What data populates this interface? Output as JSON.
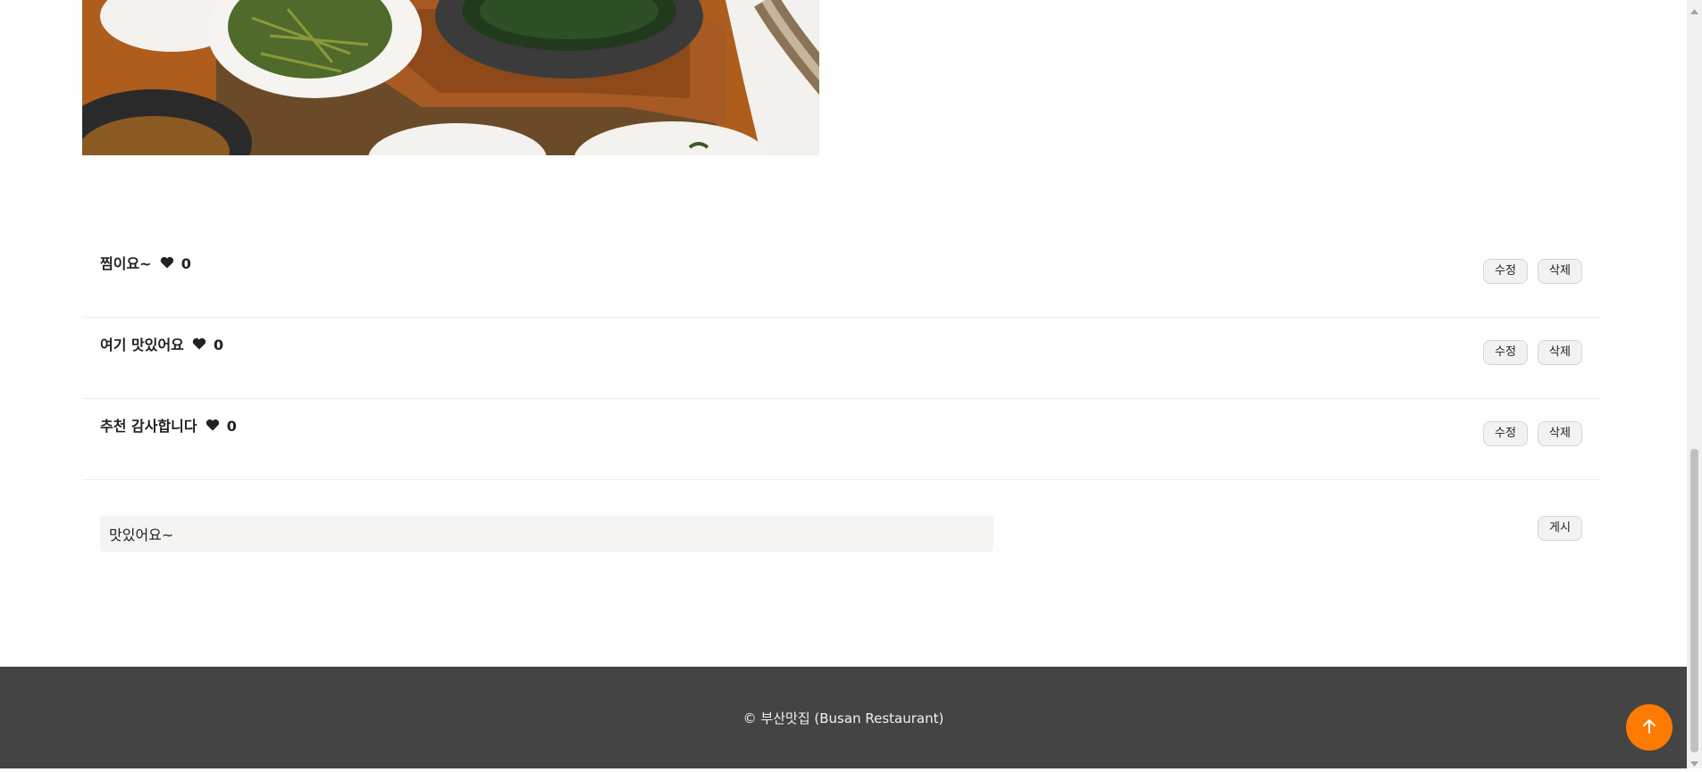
{
  "comments": [
    {
      "text": "찜이요~",
      "likes": "0",
      "edit_label": "수정",
      "delete_label": "삭제"
    },
    {
      "text": "여기 맛있어요",
      "likes": "0",
      "edit_label": "수정",
      "delete_label": "삭제"
    },
    {
      "text": "추천 감사합니다",
      "likes": "0",
      "edit_label": "수정",
      "delete_label": "삭제"
    }
  ],
  "comment_form": {
    "input_value": "맛있어요~",
    "post_label": "게시"
  },
  "footer": {
    "copyright": "© 부산맛집 (Busan Restaurant)"
  },
  "icons": {
    "like": "heart-icon",
    "scroll_top": "arrow-up-icon"
  },
  "colors": {
    "accent": "#ff7a00",
    "footer_bg": "#444444",
    "input_bg": "#f5f4f2",
    "button_bg": "#f2f2f2"
  }
}
